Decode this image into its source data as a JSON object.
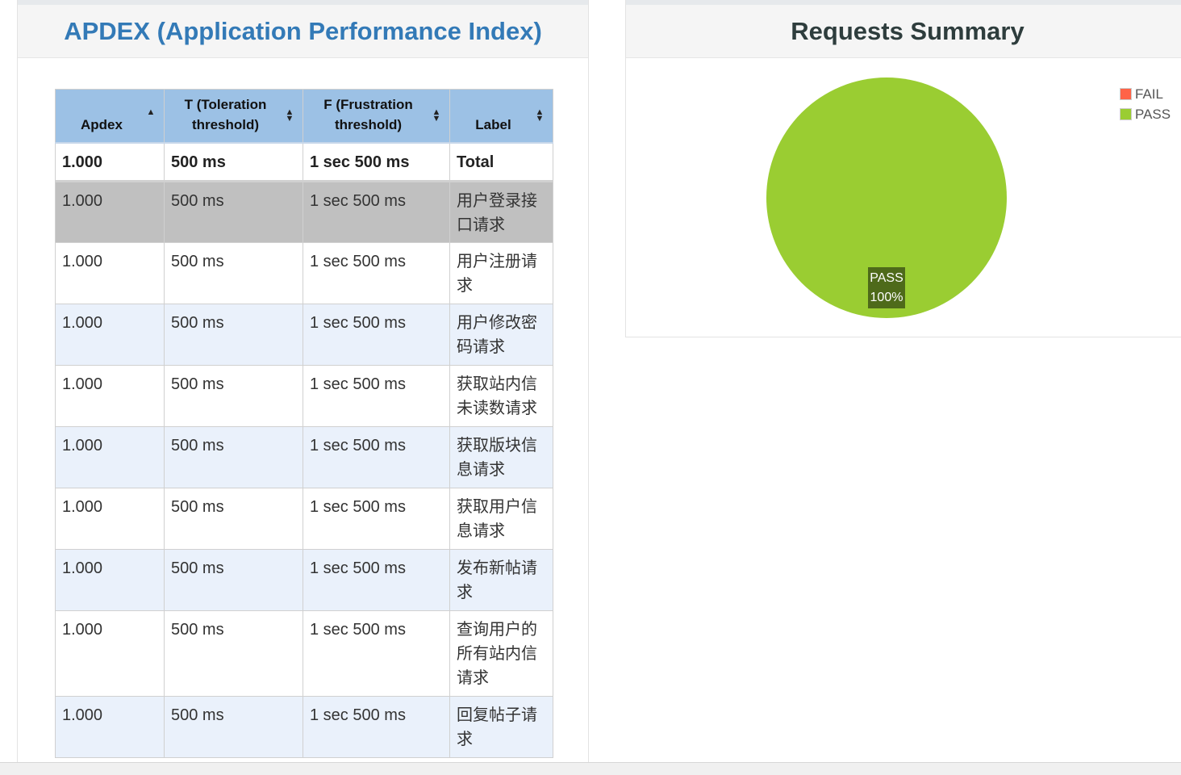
{
  "apdex_panel": {
    "title": "APDEX (Application Performance Index)",
    "columns": [
      {
        "label": "Apdex",
        "sort": "asc"
      },
      {
        "label": "T (Toleration threshold)",
        "sort": "both"
      },
      {
        "label": "F (Frustration threshold)",
        "sort": "both"
      },
      {
        "label": "Label",
        "sort": "both"
      }
    ],
    "total_row": {
      "apdex": "1.000",
      "t": "500 ms",
      "f": "1 sec 500 ms",
      "label": "Total"
    },
    "rows": [
      {
        "apdex": "1.000",
        "t": "500 ms",
        "f": "1 sec 500 ms",
        "label": "用户登录接口请求",
        "selected": true
      },
      {
        "apdex": "1.000",
        "t": "500 ms",
        "f": "1 sec 500 ms",
        "label": "用户注册请求"
      },
      {
        "apdex": "1.000",
        "t": "500 ms",
        "f": "1 sec 500 ms",
        "label": "用户修改密码请求"
      },
      {
        "apdex": "1.000",
        "t": "500 ms",
        "f": "1 sec 500 ms",
        "label": "获取站内信未读数请求"
      },
      {
        "apdex": "1.000",
        "t": "500 ms",
        "f": "1 sec 500 ms",
        "label": "获取版块信息请求"
      },
      {
        "apdex": "1.000",
        "t": "500 ms",
        "f": "1 sec 500 ms",
        "label": "获取用户信息请求"
      },
      {
        "apdex": "1.000",
        "t": "500 ms",
        "f": "1 sec 500 ms",
        "label": "发布新帖请求"
      },
      {
        "apdex": "1.000",
        "t": "500 ms",
        "f": "1 sec 500 ms",
        "label": "查询用户的所有站内信请求"
      },
      {
        "apdex": "1.000",
        "t": "500 ms",
        "f": "1 sec 500 ms",
        "label": "回复帖子请求"
      }
    ]
  },
  "requests_panel": {
    "title": "Requests Summary"
  },
  "chart_data": {
    "type": "pie",
    "title": "Requests Summary",
    "legend_position": "top-right",
    "slices": [
      {
        "name": "FAIL",
        "value": 0,
        "percent": "0%",
        "color": "#ff6347"
      },
      {
        "name": "PASS",
        "value": 100,
        "percent": "100%",
        "color": "#9acd32"
      }
    ],
    "data_label": {
      "name": "PASS",
      "percent": "100%"
    }
  },
  "colors": {
    "header_bg": "#9cc1e5",
    "selected_row": "#c0c0c0",
    "odd_row": "#eaf1fb",
    "pass": "#9acd32",
    "fail": "#ff6347",
    "title_blue": "#337ab7"
  }
}
